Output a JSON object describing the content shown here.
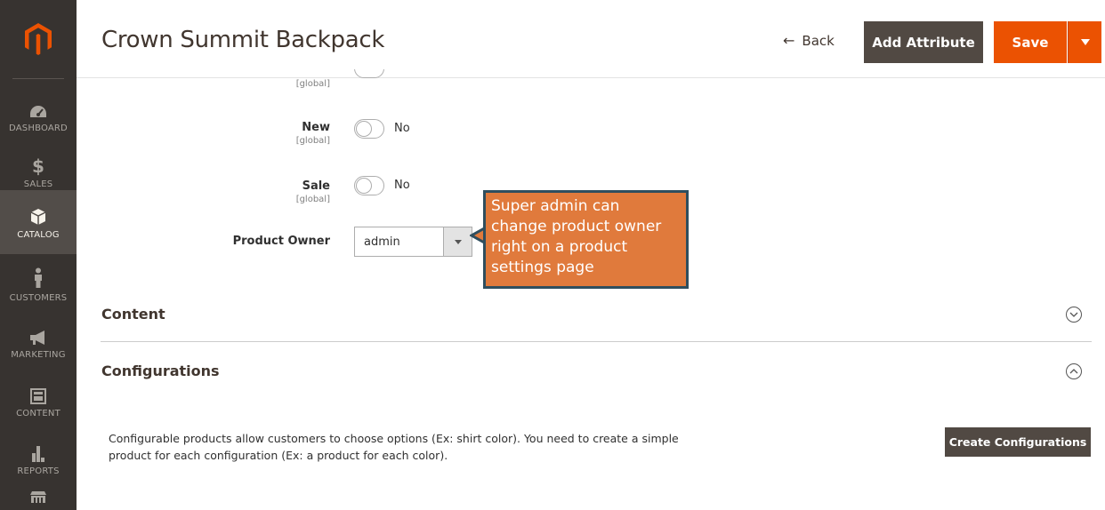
{
  "sidebar": {
    "items": [
      {
        "label": "DASHBOARD",
        "icon": "dashboard-icon"
      },
      {
        "label": "SALES",
        "icon": "dollar-icon"
      },
      {
        "label": "CATALOG",
        "icon": "cube-icon",
        "active": true
      },
      {
        "label": "CUSTOMERS",
        "icon": "person-icon"
      },
      {
        "label": "MARKETING",
        "icon": "megaphone-icon"
      },
      {
        "label": "CONTENT",
        "icon": "layout-icon"
      },
      {
        "label": "REPORTS",
        "icon": "bar-chart-icon"
      }
    ]
  },
  "header": {
    "title": "Crown Summit Backpack",
    "back_label": "Back",
    "add_attribute_label": "Add Attribute",
    "save_label": "Save"
  },
  "form": {
    "top_scope": "[global]",
    "new": {
      "label": "New",
      "scope": "[global]",
      "value": "No"
    },
    "sale": {
      "label": "Sale",
      "scope": "[global]",
      "value": "No"
    },
    "product_owner": {
      "label": "Product Owner",
      "value": "admin"
    }
  },
  "callout": {
    "lines": [
      "Super admin can",
      "change product owner",
      "right on a product",
      "settings page"
    ]
  },
  "sections": {
    "content": {
      "title": "Content"
    },
    "configurations": {
      "title": "Configurations",
      "desc_line1": "Configurable products allow customers to choose options (Ex: shirt color). You need to create a simple",
      "desc_line2": "product for each configuration (Ex: a product for each color).",
      "button_label": "Create Configurations"
    }
  },
  "colors": {
    "sidebar_bg": "#373330",
    "sidebar_active": "#524d49",
    "brand_orange": "#eb5202",
    "dark_button": "#514943",
    "callout_bg": "#e07a3c",
    "callout_border": "#2f4e5e"
  }
}
